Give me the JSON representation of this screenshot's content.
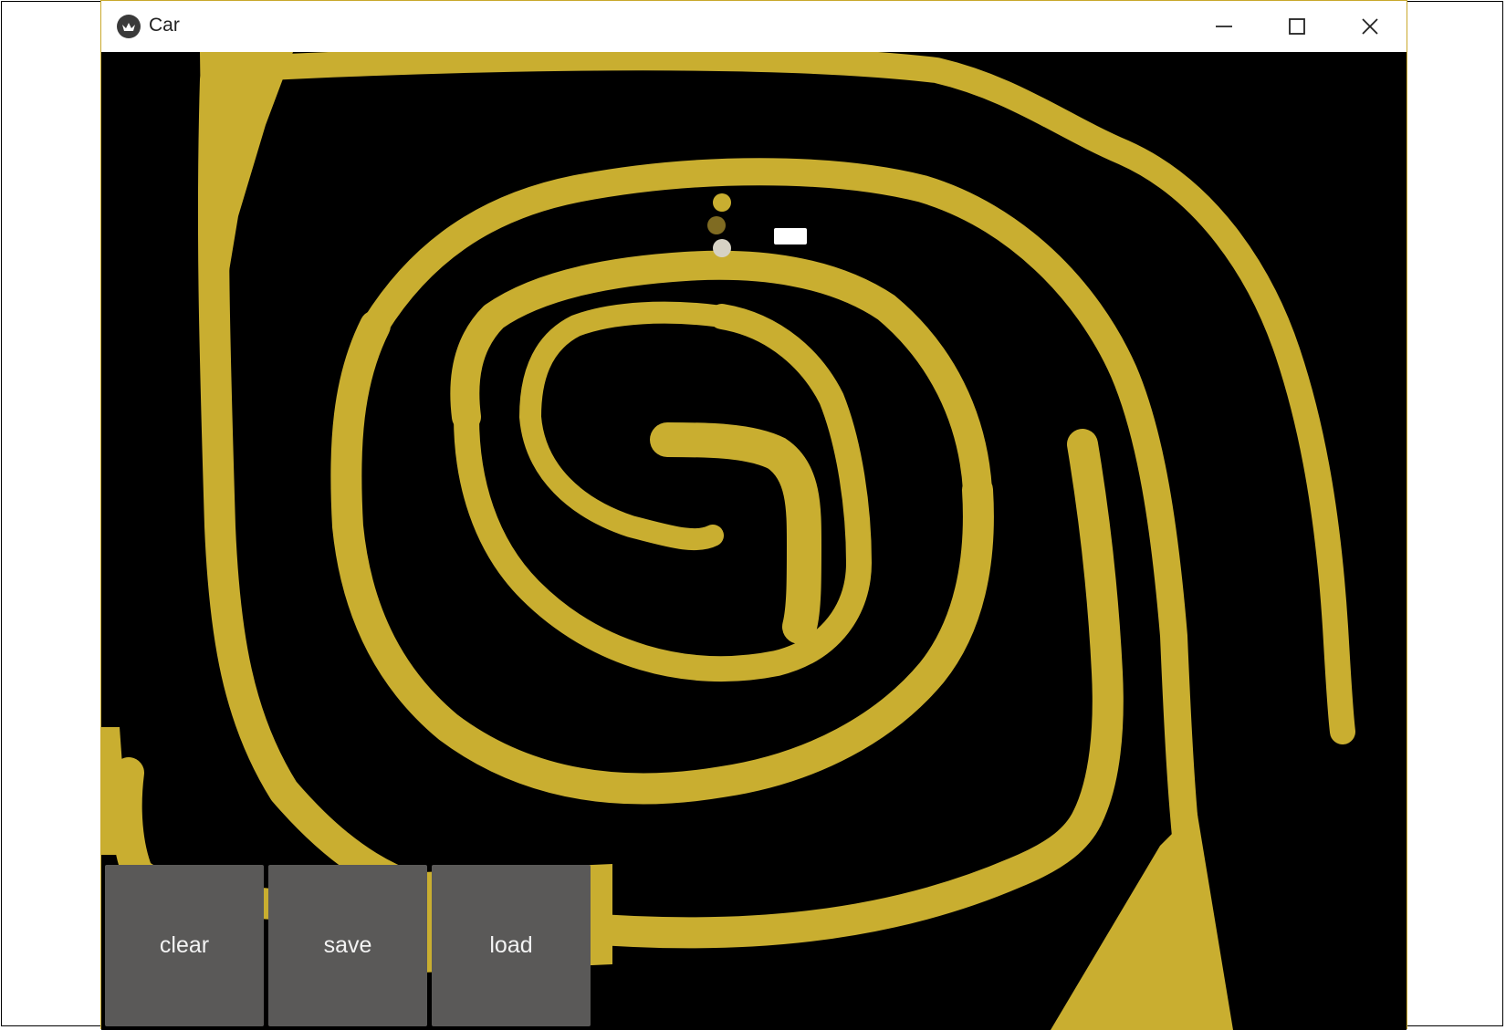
{
  "window": {
    "title": "Car",
    "controls": [
      "minimize",
      "maximize",
      "close"
    ]
  },
  "colors": {
    "track": "#c9ae30",
    "background": "#000000",
    "button": "#5a5958",
    "button_text": "#f3f3f3",
    "car": "#ffffff",
    "sensor_top": "#c9ae30",
    "sensor_mid": "#7f6b22",
    "sensor_bottom": "#d6d2c4"
  },
  "icons": {
    "app": "kivy-logo-icon",
    "minimize": "minimize-icon",
    "maximize": "maximize-icon",
    "close": "close-icon"
  },
  "buttons": {
    "clear": "clear",
    "save": "save",
    "load": "load"
  }
}
